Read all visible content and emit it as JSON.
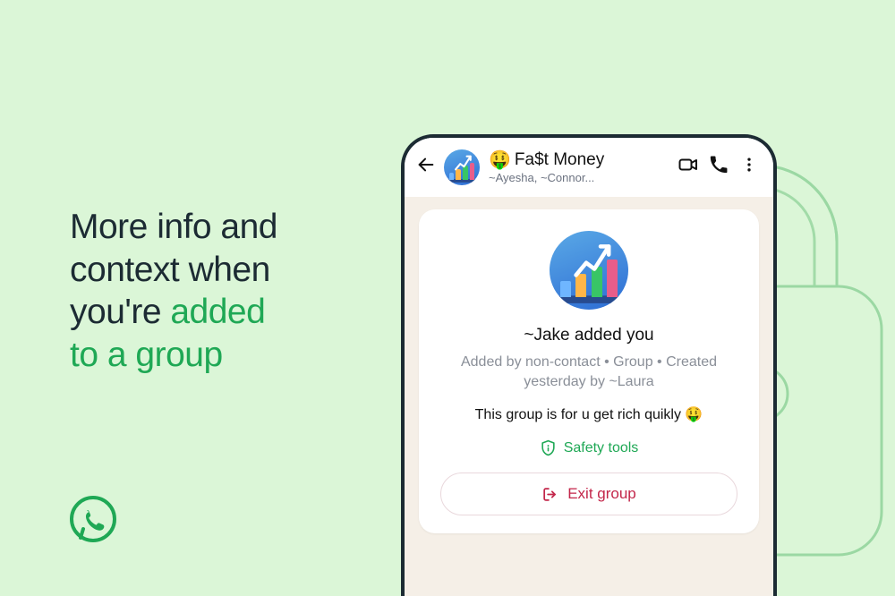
{
  "headline": {
    "line1": "More info and",
    "line2": "context when",
    "line3_a": "you're ",
    "line3_b": "added",
    "line4": "to a group"
  },
  "header": {
    "emoji": "🤑",
    "group_name": "Fa$t Money",
    "members_preview": "~Ayesha, ~Connor..."
  },
  "card": {
    "added_by": "~Jake added you",
    "meta": "Added by non-contact • Group • Created yesterday by ~Laura",
    "description_text": "This group is for u get rich quikly ",
    "description_emoji": "🤑",
    "safety_label": "Safety tools",
    "exit_label": "Exit group"
  }
}
